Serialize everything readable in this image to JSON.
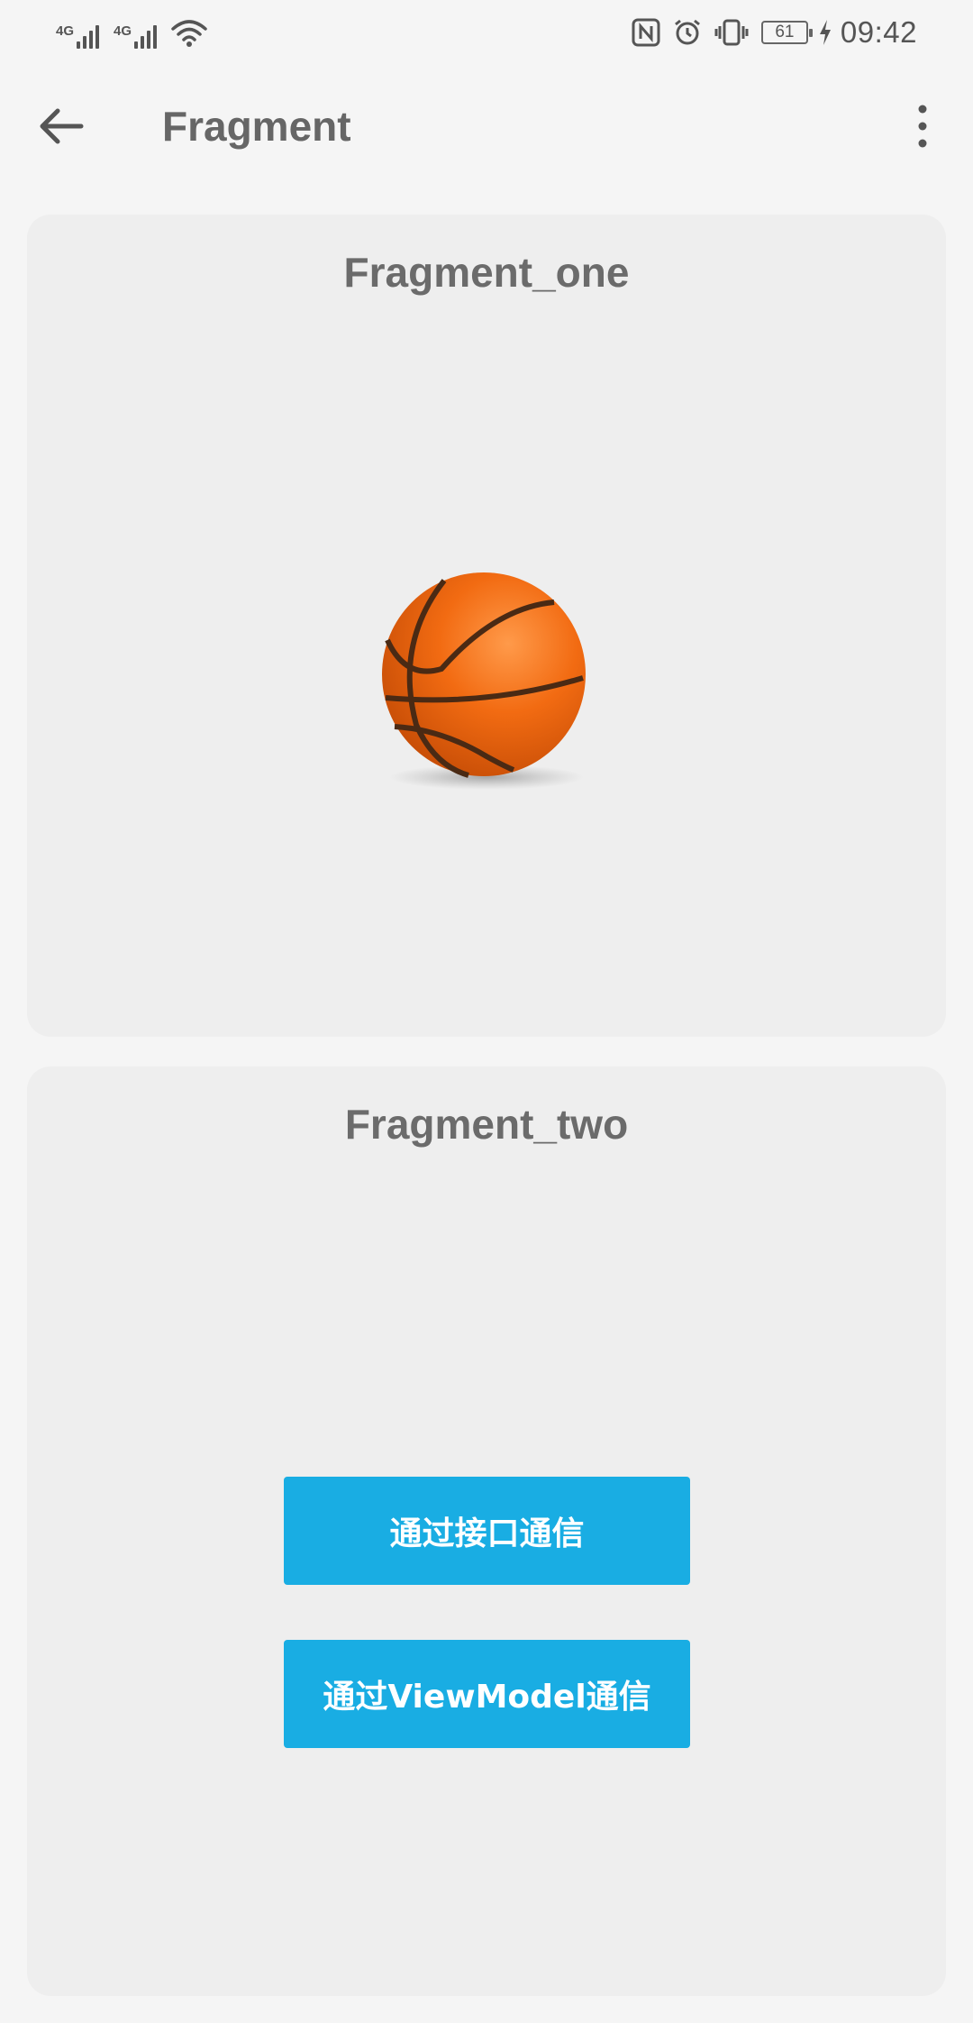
{
  "status_bar": {
    "signal_1_label": "4G",
    "signal_2_label": "4G",
    "battery_level": "61",
    "time": "09:42",
    "icons": [
      "nfc-icon",
      "alarm-icon",
      "vibrate-icon",
      "battery-icon",
      "charging-icon"
    ]
  },
  "app_bar": {
    "title": "Fragment",
    "back_icon": "arrow-back-icon",
    "overflow_icon": "more-vert-icon"
  },
  "fragment_one": {
    "title": "Fragment_one",
    "image": "basketball"
  },
  "fragment_two": {
    "title": "Fragment_two",
    "button_interface_label": "通过接口通信",
    "button_viewmodel_label": "通过ViewModel通信"
  },
  "colors": {
    "background": "#f5f5f5",
    "card": "#eeeeee",
    "accent_button": "#19ade3",
    "title_text": "#666666"
  }
}
